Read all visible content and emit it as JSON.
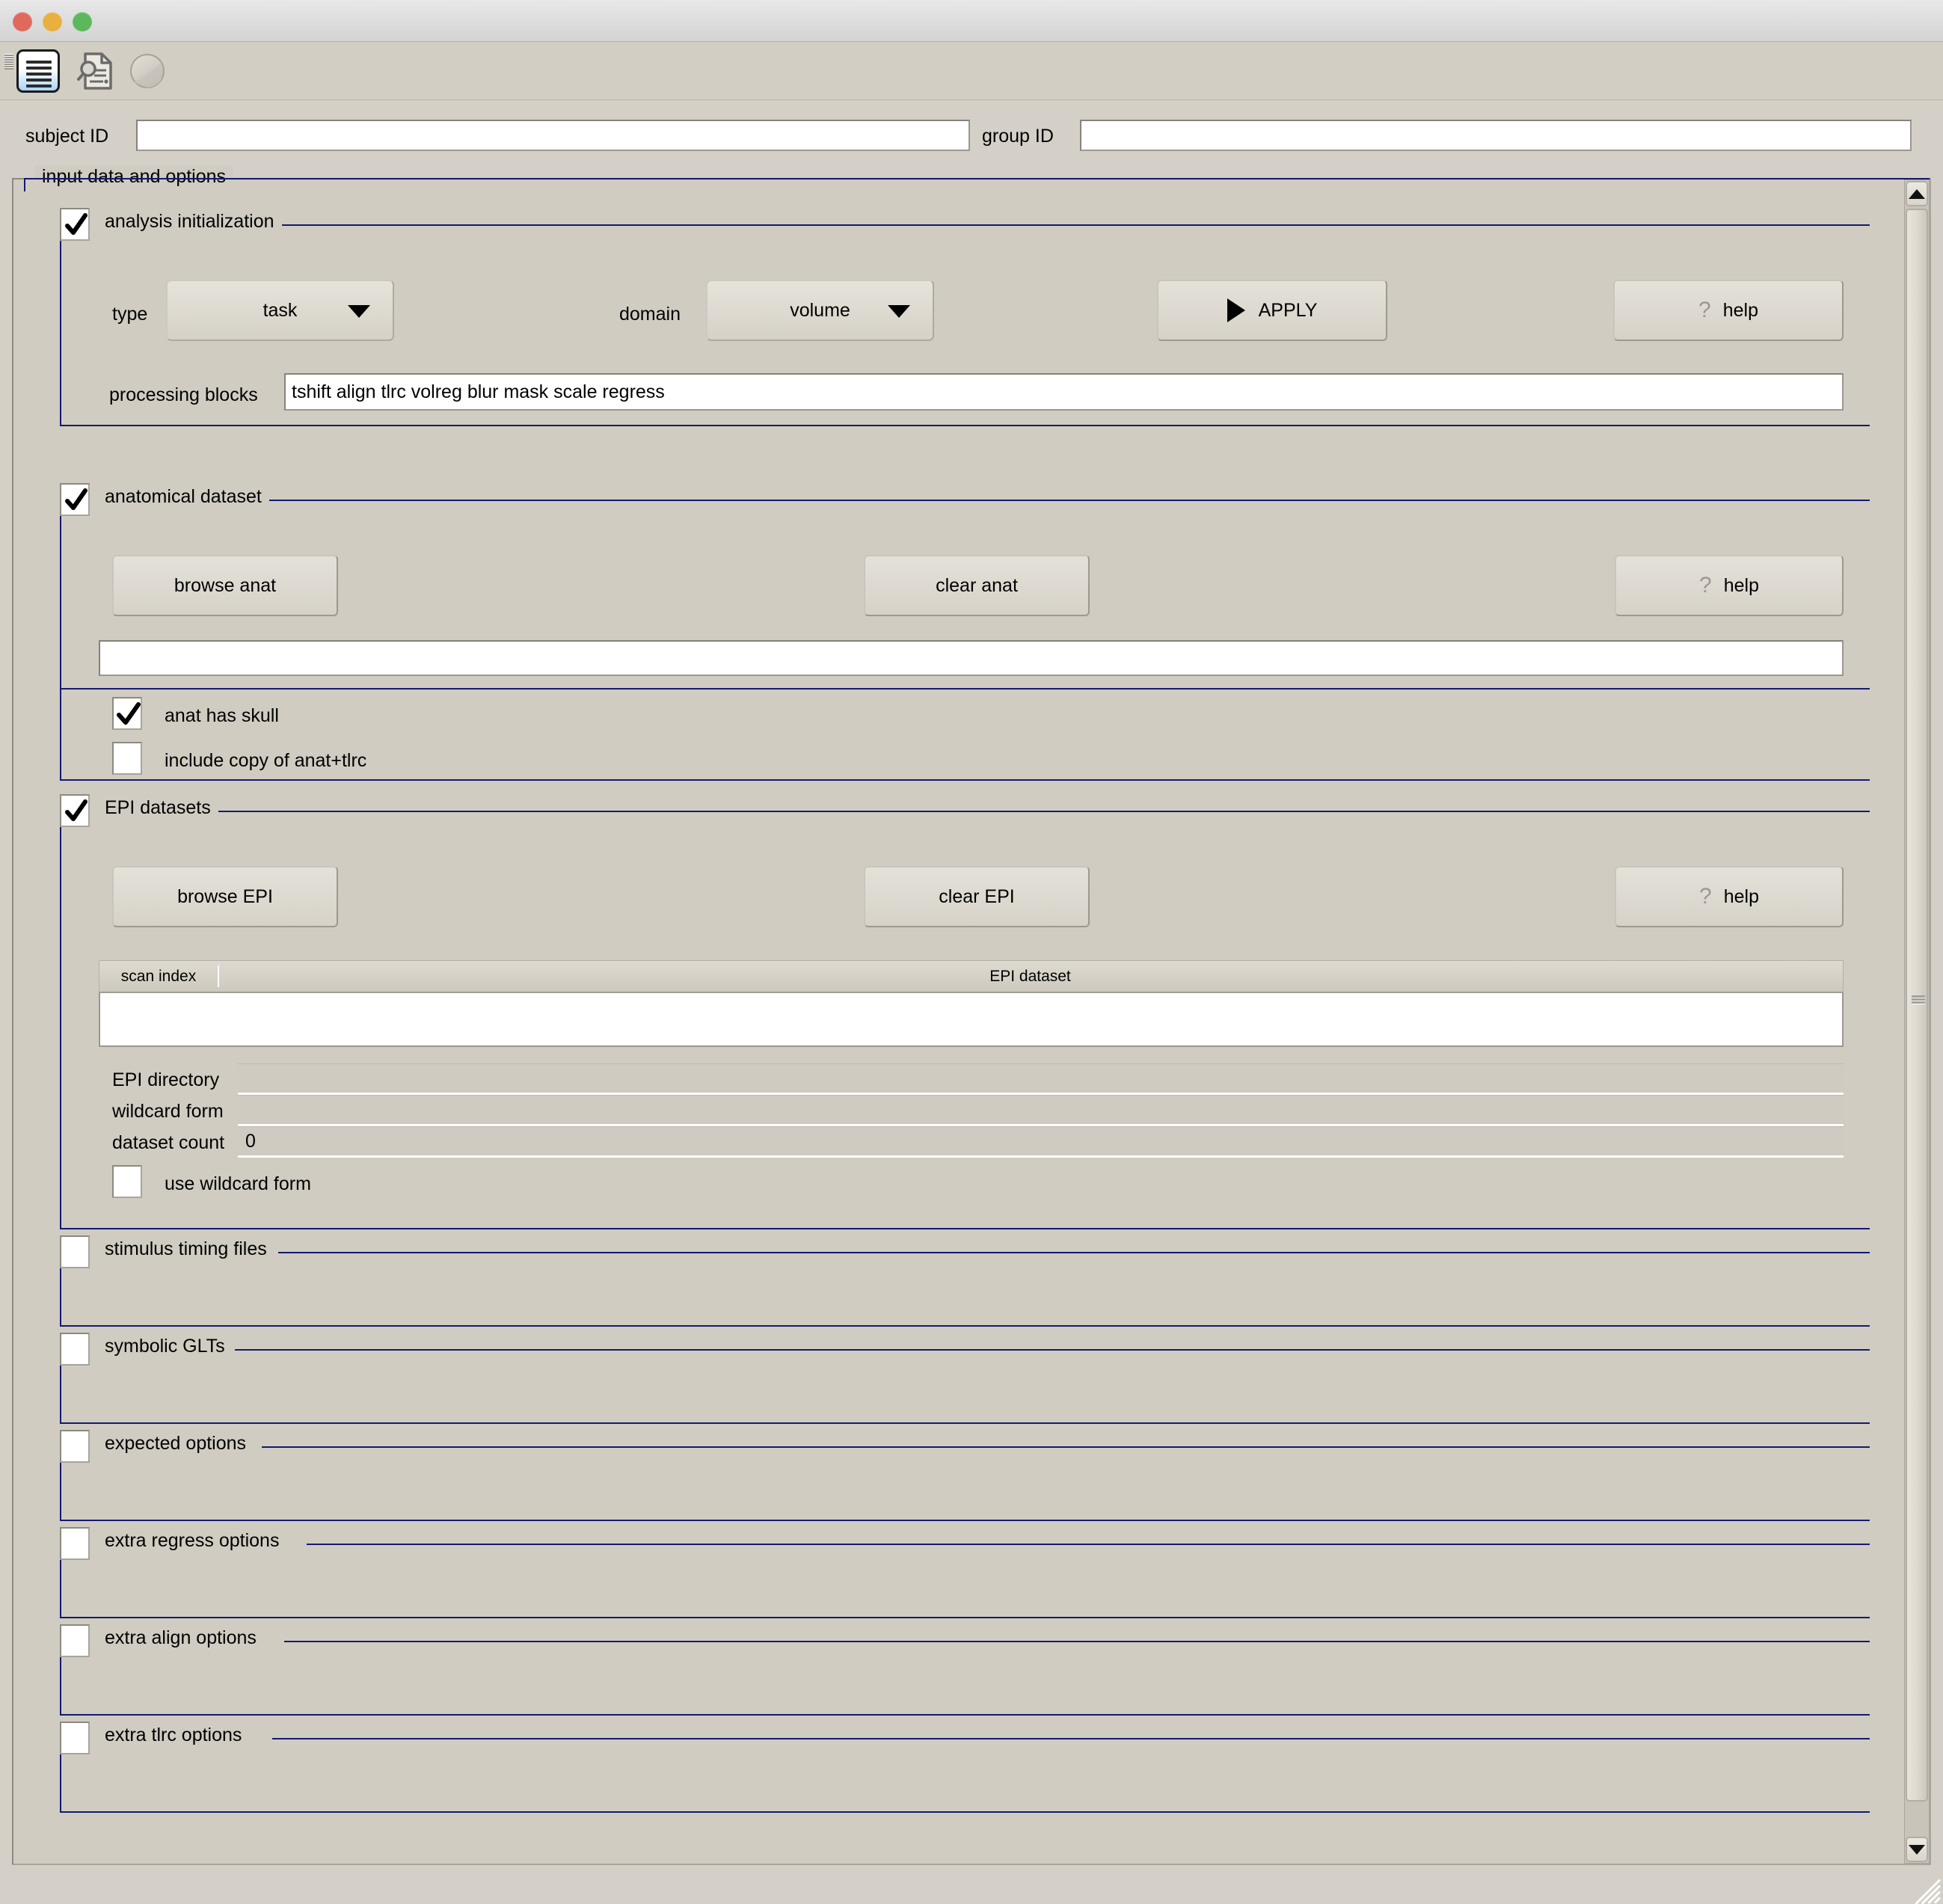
{
  "window": {
    "traffic_lights": [
      "close",
      "minimize",
      "zoom"
    ],
    "toolbar_icons": [
      "lines-document-icon",
      "document-search-icon",
      "circle-icon"
    ]
  },
  "top": {
    "subject_id_label": "subject ID",
    "subject_id_value": "",
    "group_id_label": "group ID",
    "group_id_value": ""
  },
  "panel": {
    "title": "input data and options"
  },
  "analysis_init": {
    "title": "analysis initialization",
    "checked": true,
    "type_label": "type",
    "type_value": "task",
    "domain_label": "domain",
    "domain_value": "volume",
    "apply_label": "APPLY",
    "help_label": "help",
    "blocks_label": "processing blocks",
    "blocks_value": "tshift align tlrc volreg blur mask scale regress"
  },
  "anat": {
    "title": "anatomical dataset",
    "checked": true,
    "browse_label": "browse anat",
    "clear_label": "clear anat",
    "help_label": "help",
    "path_value": "",
    "has_skull_label": "anat has skull",
    "has_skull_checked": true,
    "copy_tlrc_label": "include copy of anat+tlrc",
    "copy_tlrc_checked": false
  },
  "epi": {
    "title": "EPI datasets",
    "checked": true,
    "browse_label": "browse EPI",
    "clear_label": "clear EPI",
    "help_label": "help",
    "table": {
      "columns": [
        "scan index",
        "EPI dataset"
      ],
      "rows": []
    },
    "directory_label": "EPI directory",
    "directory_value": "",
    "wildcard_label": "wildcard form",
    "wildcard_value": "",
    "count_label": "dataset count",
    "count_value": "0",
    "use_wildcard_label": "use wildcard form",
    "use_wildcard_checked": false
  },
  "collapsed_sections": [
    {
      "title": "stimulus timing files",
      "checked": false
    },
    {
      "title": "symbolic GLTs",
      "checked": false
    },
    {
      "title": "expected options",
      "checked": false
    },
    {
      "title": "extra regress options",
      "checked": false
    },
    {
      "title": "extra align options",
      "checked": false
    },
    {
      "title": "extra tlrc options",
      "checked": false
    }
  ],
  "colors": {
    "window_bg": "#d0ccc2",
    "groupbox_border": "#151a6e",
    "field_bg": "#ffffff",
    "button_face": "#ddd9d0"
  }
}
